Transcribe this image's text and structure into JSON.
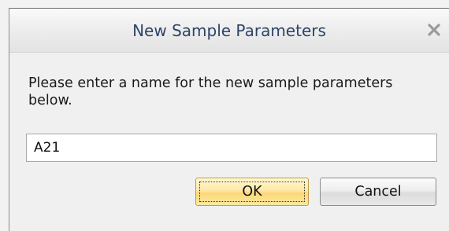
{
  "dialog": {
    "title": "New Sample Parameters",
    "close_icon": "close-icon",
    "prompt": "Please enter a name for the new sample parameters below.",
    "name_input": {
      "value": "A21"
    },
    "ok_label": "OK",
    "cancel_label": "Cancel"
  },
  "colors": {
    "title_text": "#2d4468",
    "ok_button": "#fbd879",
    "cancel_button": "#e8e8e8"
  }
}
